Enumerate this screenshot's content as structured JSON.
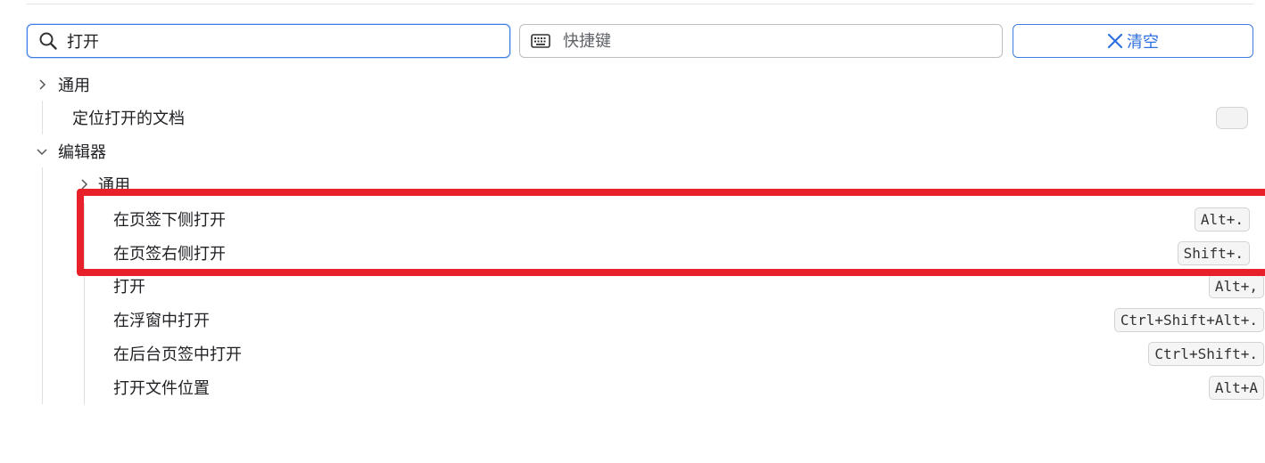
{
  "search": {
    "value": "打开"
  },
  "shortcut_search": {
    "placeholder": "快捷键"
  },
  "clear_button": {
    "label": "清空"
  },
  "tree": {
    "general_group": {
      "label": "通用",
      "expanded": false
    },
    "general_item": {
      "label": "定位打开的文档"
    },
    "editor_group": {
      "label": "编辑器",
      "expanded": true
    },
    "editor_general_group": {
      "label": "通用",
      "expanded": false
    },
    "editor_items": [
      {
        "label": "在页签下侧打开",
        "shortcut": "Alt+."
      },
      {
        "label": "在页签右侧打开",
        "shortcut": "Shift+."
      },
      {
        "label": "打开",
        "shortcut": "Alt+,"
      },
      {
        "label": "在浮窗中打开",
        "shortcut": "Ctrl+Shift+Alt+."
      },
      {
        "label": "在后台页签中打开",
        "shortcut": "Ctrl+Shift+."
      },
      {
        "label": "打开文件位置",
        "shortcut": "Alt+A"
      }
    ]
  },
  "colors": {
    "accent": "#2f6fe0",
    "highlight": "#e8202a"
  },
  "icons": {
    "search": "search-icon",
    "keyboard": "keyboard-icon",
    "clear": "close-icon",
    "collapsed": "chevron-right-icon",
    "expanded": "chevron-down-icon"
  }
}
